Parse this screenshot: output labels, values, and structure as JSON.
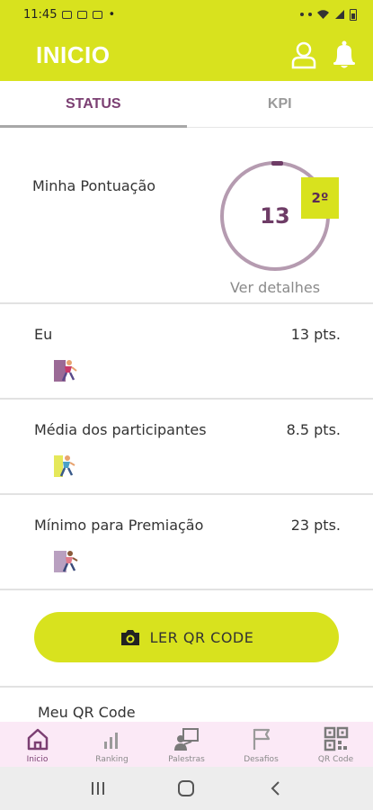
{
  "status_bar": {
    "time": "11:45",
    "dot": "•"
  },
  "header": {
    "title": "INICIO",
    "icons": [
      "user-icon",
      "bell-icon"
    ]
  },
  "tabs": [
    {
      "label": "STATUS",
      "active": true
    },
    {
      "label": "KPI",
      "active": false
    }
  ],
  "score": {
    "label": "Minha Pontuação",
    "value": "13",
    "rank": "2º",
    "details_link": "Ver detalhes"
  },
  "stats": [
    {
      "label": "Eu",
      "value": "13 pts.",
      "icon": "runner-icon"
    },
    {
      "label": "Média dos participantes",
      "value": "8.5 pts.",
      "icon": "runner-icon"
    },
    {
      "label": "Mínimo para Premiação",
      "value": "23 pts.",
      "icon": "runner-icon"
    }
  ],
  "qr_button": {
    "label": "LER QR CODE",
    "icon": "camera-icon"
  },
  "my_qr": {
    "label": "Meu QR Code"
  },
  "bottom_nav": [
    {
      "label": "Inicio",
      "icon": "home-icon",
      "active": true
    },
    {
      "label": "Ranking",
      "icon": "bar-chart-icon",
      "active": false
    },
    {
      "label": "Palestras",
      "icon": "presentation-icon",
      "active": false
    },
    {
      "label": "Desafios",
      "icon": "flag-icon",
      "active": false
    },
    {
      "label": "QR Code",
      "icon": "qr-code-icon",
      "active": false
    }
  ],
  "colors": {
    "accent": "#d8e21e",
    "primary": "#7b3f72",
    "ring": "#b59bb0",
    "nav_bg": "#fbe9f6"
  }
}
